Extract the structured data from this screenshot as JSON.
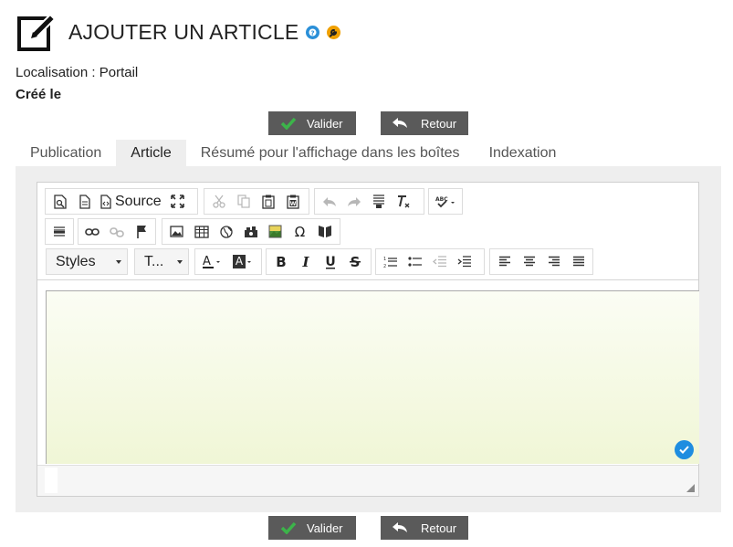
{
  "header": {
    "title": "AJOUTER UN ARTICLE",
    "icons": [
      "edit-icon",
      "help-icon",
      "wrench-icon"
    ]
  },
  "meta": {
    "localisation": "Localisation : Portail",
    "created": "Créé le"
  },
  "actions": {
    "validate_label": "Valider",
    "back_label": "Retour"
  },
  "tabs": [
    {
      "label": "Publication",
      "active": false
    },
    {
      "label": "Article",
      "active": true
    },
    {
      "label": "Résumé pour l'affichage dans les boîtes",
      "active": false
    },
    {
      "label": "Indexation",
      "active": false
    }
  ],
  "editor": {
    "source_label": "Source",
    "styles_label": "Styles",
    "font_label": "T...",
    "content": ""
  },
  "colors": {
    "button_bg": "#5a5a5a",
    "check_green": "#3cb44a",
    "tab_active_bg": "#eeeeee",
    "badge_blue": "#1e8de0",
    "help_blue": "#2a8fd8",
    "wrench_orange": "#f0a000"
  }
}
